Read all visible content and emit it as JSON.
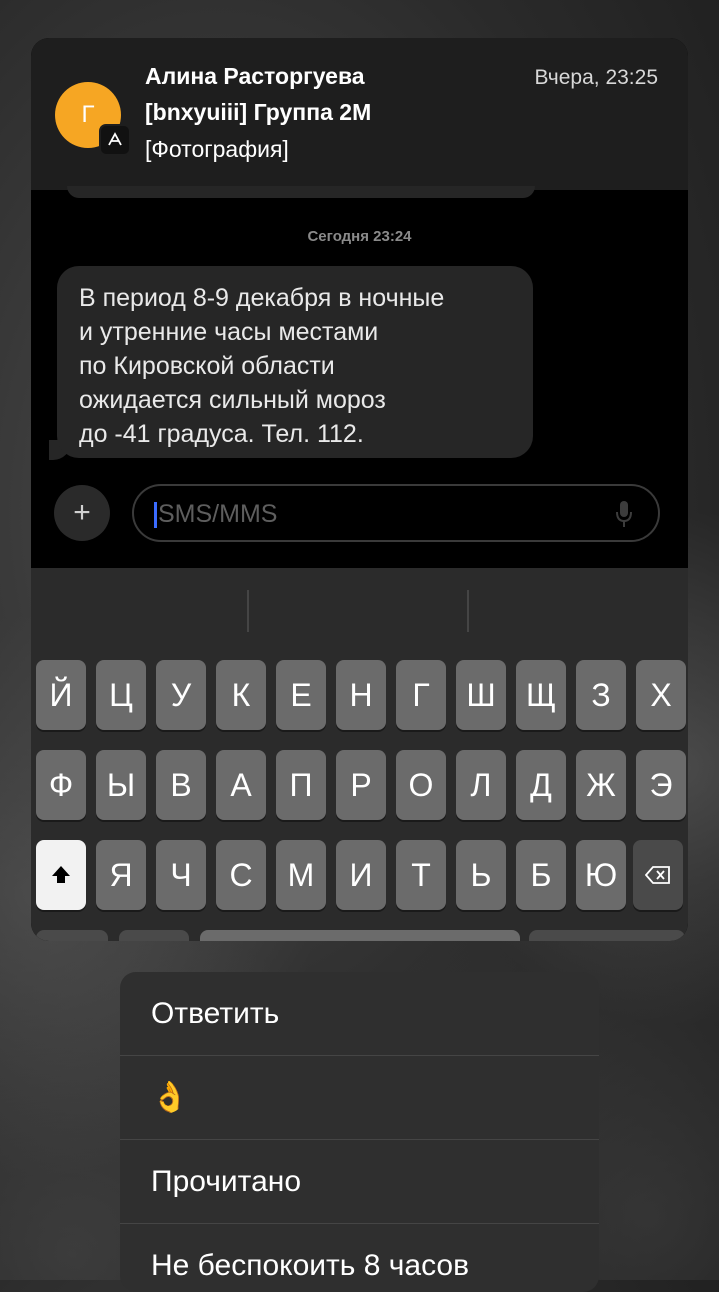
{
  "notification": {
    "avatar_letter": "Г",
    "sender": "Алина Расторгуева",
    "title": "[bnxyuiii] Группа 2М",
    "body": "[Фотография]",
    "time": "Вчера, 23:25"
  },
  "conversation": {
    "timestamp": "Сегодня 23:24",
    "message_lines": [
      "В период 8-9 декабря в ночные",
      "и утренние часы местами",
      "по Кировской области",
      "ожидается сильный мороз",
      "до -41 градуса. Тел. 112."
    ],
    "input_placeholder": "SMS/MMS",
    "plus_label": "+"
  },
  "keyboard": {
    "row1": [
      "Й",
      "Ц",
      "У",
      "К",
      "Е",
      "Н",
      "Г",
      "Ш",
      "Щ",
      "З",
      "Х"
    ],
    "row2": [
      "Ф",
      "Ы",
      "В",
      "А",
      "П",
      "Р",
      "О",
      "Л",
      "Д",
      "Ж",
      "Э"
    ],
    "row3": [
      "Я",
      "Ч",
      "С",
      "М",
      "И",
      "Т",
      "Ь",
      "Б",
      "Ю"
    ]
  },
  "menu": {
    "items": [
      "Ответить",
      "👌",
      "Прочитано",
      "Не беспокоить 8 часов"
    ]
  }
}
